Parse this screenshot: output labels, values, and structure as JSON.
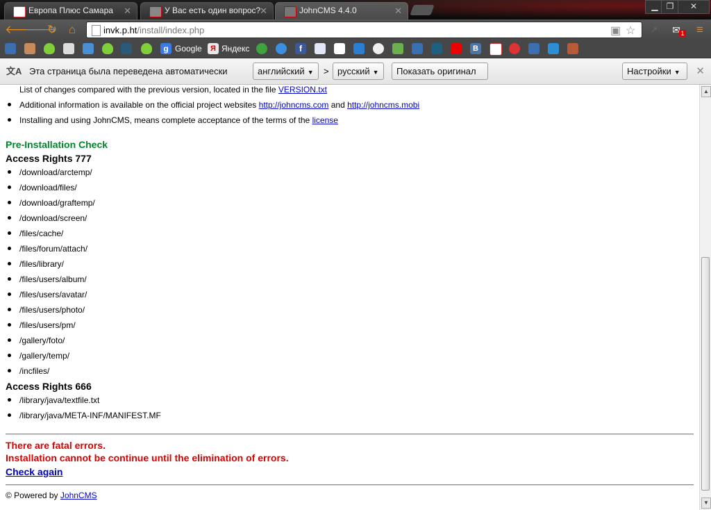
{
  "tabs": [
    {
      "title": "Европа Плюс Самара",
      "active": false
    },
    {
      "title": "У Вас есть один вопрос? ·",
      "active": false
    },
    {
      "title": "JohnCMS 4.4.0",
      "active": true
    }
  ],
  "toolbar": {
    "url_host": "invk.p.ht",
    "url_path": "/install/index.php",
    "mail_badge": "1"
  },
  "bookmarks": {
    "google_label": "Google",
    "yandex_label": "Яндекс"
  },
  "translate_bar": {
    "message": "Эта страница была переведена автоматически",
    "from_lang": "английский",
    "separator": ">",
    "to_lang": "русский",
    "show_original": "Показать оригинал",
    "settings": "Настройки"
  },
  "content": {
    "version_text": "List of changes compared with the previous version, located in the file",
    "version_link": "VERSION.txt",
    "info_text": "Additional information is available on the official project websites",
    "info_link1": "http://johncms.com",
    "info_and": "and",
    "info_link2": "http://johncms.mobi",
    "license_text": "Installing and using JohnCMS, means complete acceptance of the terms of the",
    "license_link": "license",
    "preinstall_heading": "Pre-Installation Check",
    "rights777_heading": "Access Rights 777",
    "rights777": [
      "/download/arctemp/",
      "/download/files/",
      "/download/graftemp/",
      "/download/screen/",
      "/files/cache/",
      "/files/forum/attach/",
      "/files/library/",
      "/files/users/album/",
      "/files/users/avatar/",
      "/files/users/photo/",
      "/files/users/pm/",
      "/gallery/foto/",
      "/gallery/temp/",
      "/incfiles/"
    ],
    "rights666_heading": "Access Rights 666",
    "rights666": [
      "/library/java/textfile.txt",
      "/library/java/META-INF/MANIFEST.MF"
    ],
    "error1": "There are fatal errors.",
    "error2": "Installation cannot be continue until the elimination of errors.",
    "check_again": "Check again",
    "powered_prefix": "© Powered by",
    "powered_link": "JohnCMS"
  },
  "colors": {
    "heading_green": "#00852b",
    "error_red": "#d90000",
    "link_blue": "#0000cc"
  }
}
